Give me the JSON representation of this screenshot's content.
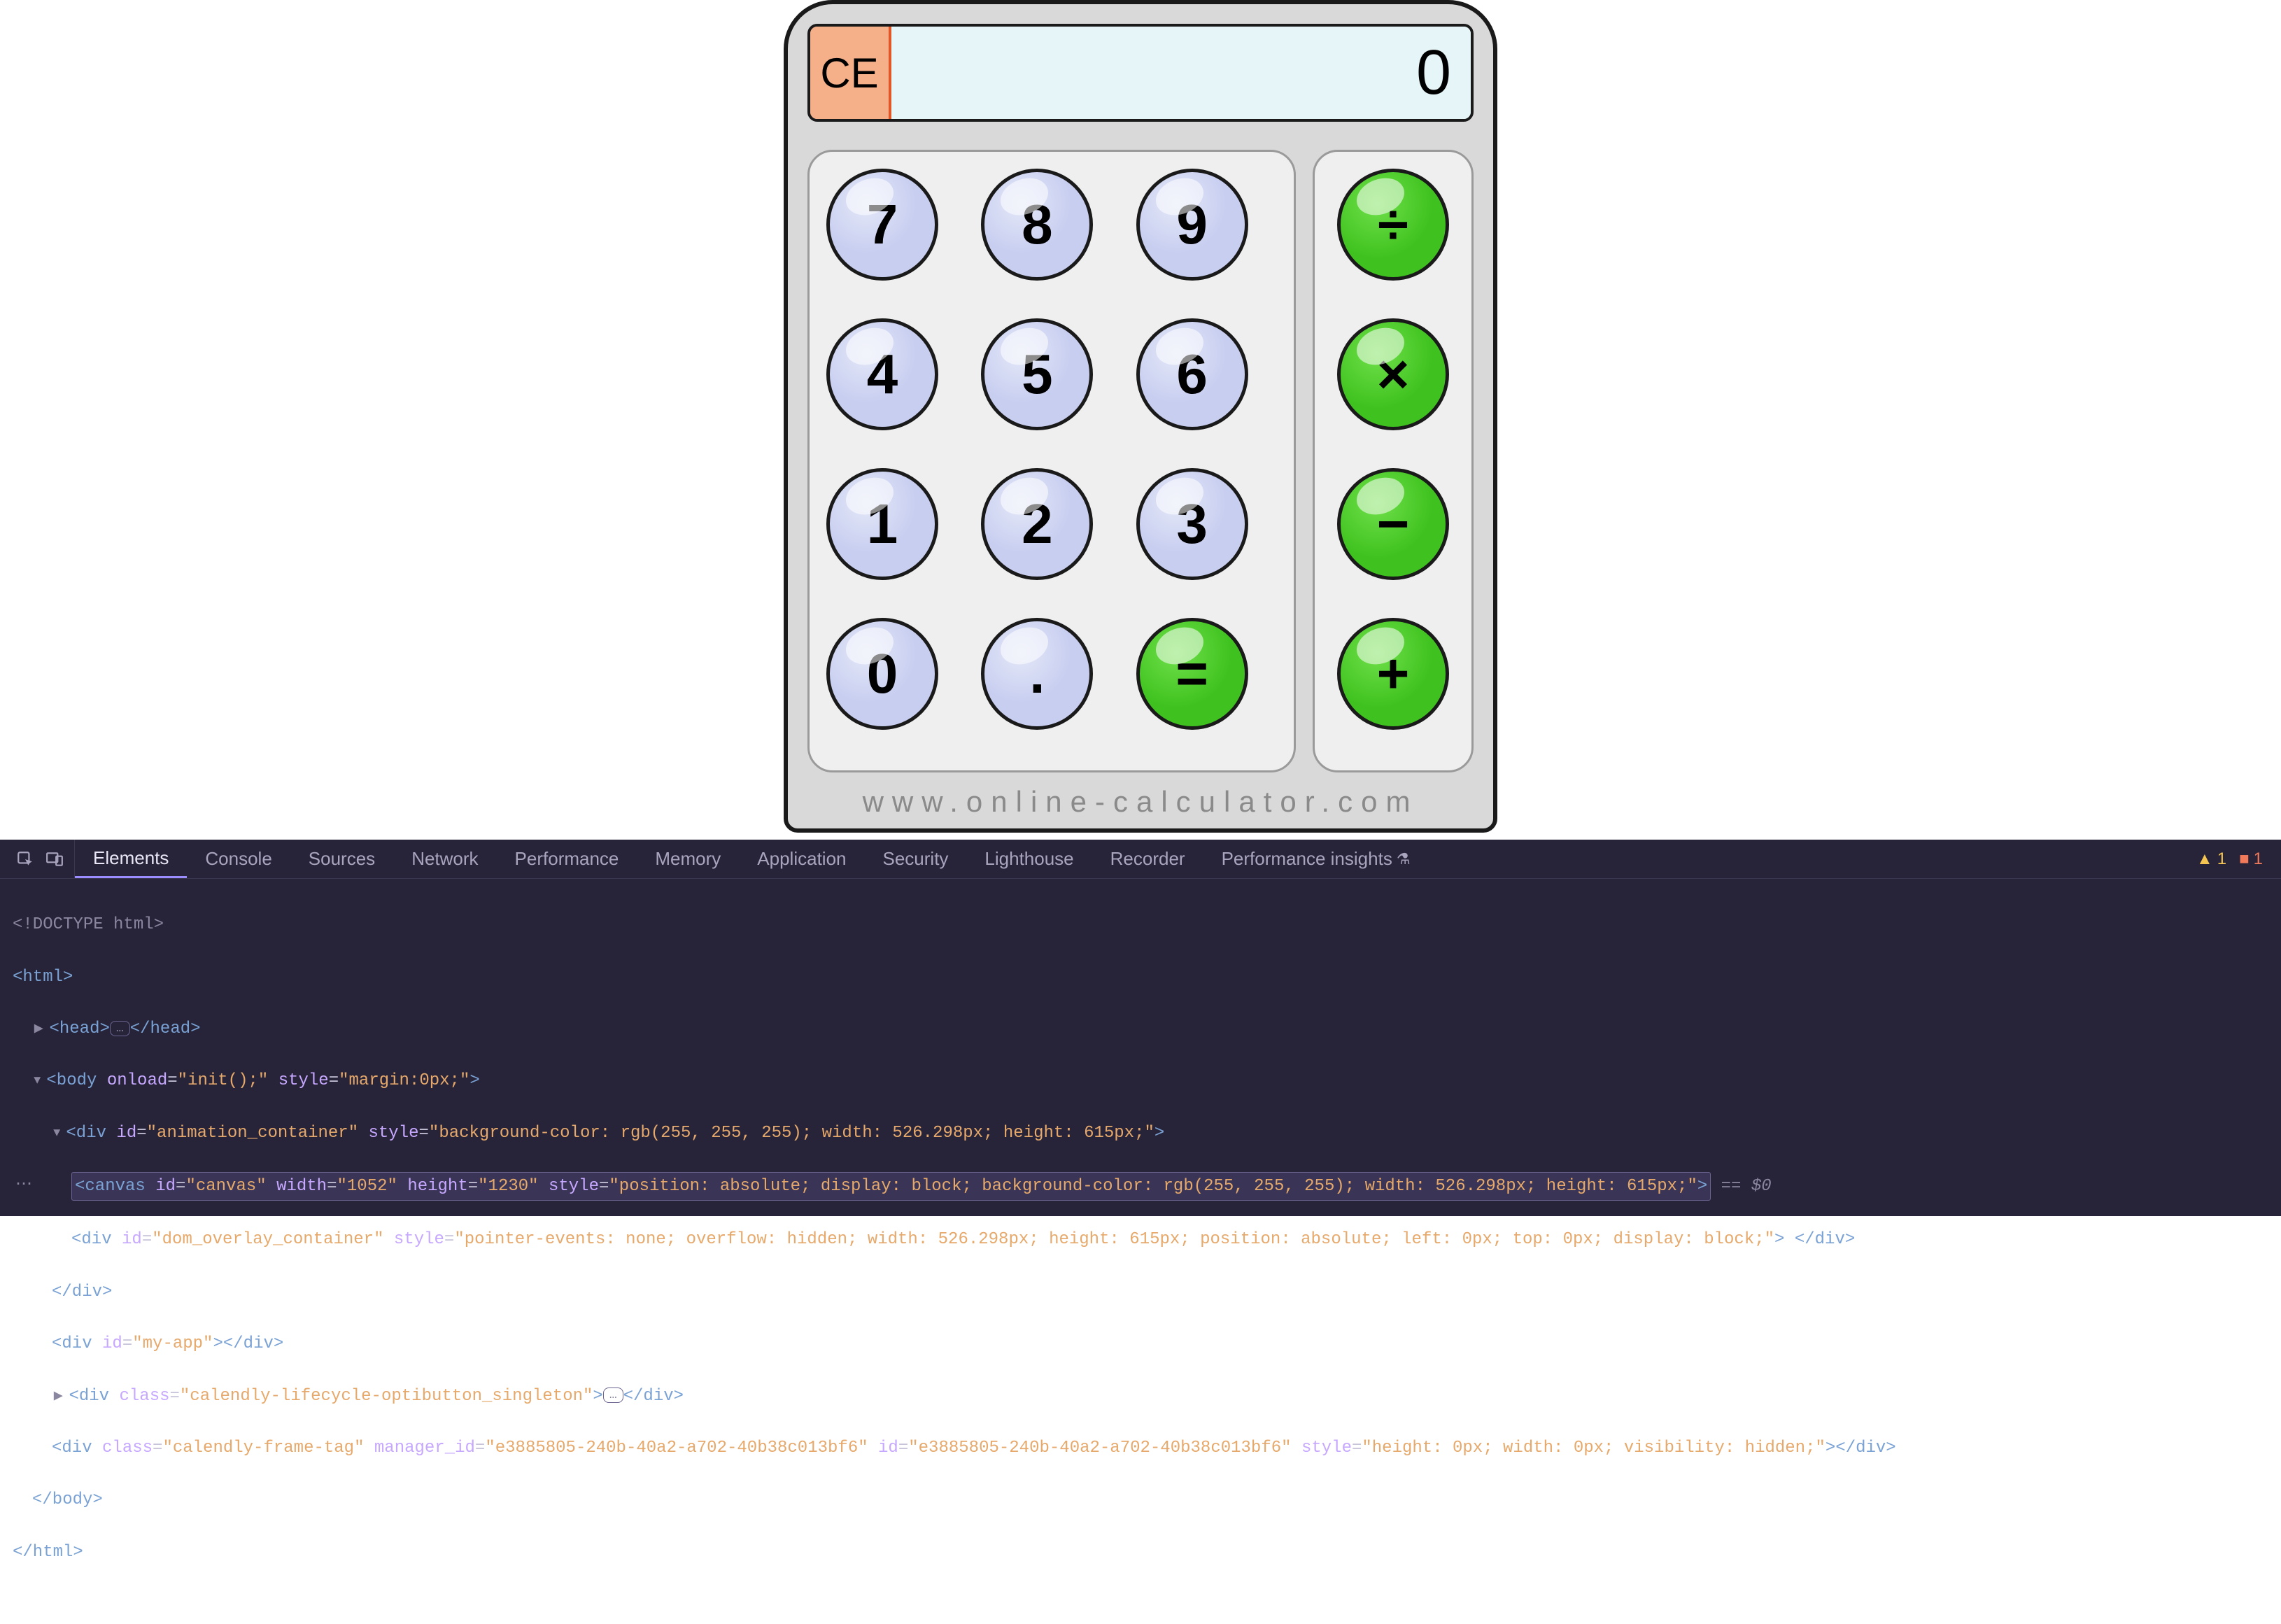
{
  "calculator": {
    "ce_label": "CE",
    "display_value": "0",
    "keys": {
      "k7": "7",
      "k8": "8",
      "k9": "9",
      "k4": "4",
      "k5": "5",
      "k6": "6",
      "k1": "1",
      "k2": "2",
      "k3": "3",
      "k0": "0",
      "kdot": ".",
      "keq": "=",
      "div": "÷",
      "mul": "×",
      "sub": "−",
      "add": "+"
    },
    "footer_url": "www.online-calculator.com"
  },
  "devtools": {
    "tabs": {
      "elements": "Elements",
      "console": "Console",
      "sources": "Sources",
      "network": "Network",
      "performance": "Performance",
      "memory": "Memory",
      "application": "Application",
      "security": "Security",
      "lighthouse": "Lighthouse",
      "recorder": "Recorder",
      "perf_insights": "Performance insights"
    },
    "warnings_count": "1",
    "errors_count": "1",
    "dom": {
      "line0": "<!DOCTYPE html>",
      "line1": "<html>",
      "line2_open": "<head>",
      "line2_ell": "…",
      "line2_close": "</head>",
      "line3a": "<body ",
      "line3_onload_n": "onload",
      "line3_onload_v": "\"init();\"",
      "line3_style_n": "style",
      "line3_style_v": "\"margin:0px;\"",
      "line3b": ">",
      "line4a": "<div ",
      "line4_id_n": "id",
      "line4_id_v": "\"animation_container\"",
      "line4_style_n": "style",
      "line4_style_v": "\"background-color: rgb(255, 255, 255); width: 526.298px; height: 615px;\"",
      "line4b": ">",
      "line5a": "<canvas ",
      "line5_id_n": "id",
      "line5_id_v": "\"canvas\"",
      "line5_w_n": "width",
      "line5_w_v": "\"1052\"",
      "line5_h_n": "height",
      "line5_h_v": "\"1230\"",
      "line5_style_n": "style",
      "line5_style_v": "\"position: absolute; display: block; background-color: rgb(255, 255, 255); width: 526.298px; height: 615px;\"",
      "line5b": ">",
      "line5_suffix": " == $0",
      "line6a": "<div ",
      "line6_id_n": "id",
      "line6_id_v": "\"dom_overlay_container\"",
      "line6_style_n": "style",
      "line6_style_v": "\"pointer-events: none; overflow: hidden; width: 526.298px; height: 615px; position: absolute; left: 0px; top: 0px; display: block;\"",
      "line6b": "> </div>",
      "line7": "</div>",
      "line8": "<div id=\"my-app\"></div>",
      "line8_id_n": "id",
      "line8_id_v": "\"my-app\"",
      "line9a": "<div ",
      "line9_cls_n": "class",
      "line9_cls_v": "\"calendly-lifecycle-optibutton_singleton\"",
      "line9b": "> </div>",
      "line10a": "<div ",
      "line10_cls_n": "class",
      "line10_cls_v": "\"calendly-frame-tag\"",
      "line10_mgr_n": "manager_id",
      "line10_mgr_v": "\"e3885805-240b-40a2-a702-40b38c013bf6\"",
      "line10_id_n": "id",
      "line10_id_v": "\"e3885805-240b-40a2-a702-40b38c013bf6\"",
      "line10_style_n": "style",
      "line10_style_v": "\"height: 0px; width: 0px; visibility: hidden;\"",
      "line10b": "></div>",
      "line11": "</body>",
      "line12": "</html>"
    }
  }
}
